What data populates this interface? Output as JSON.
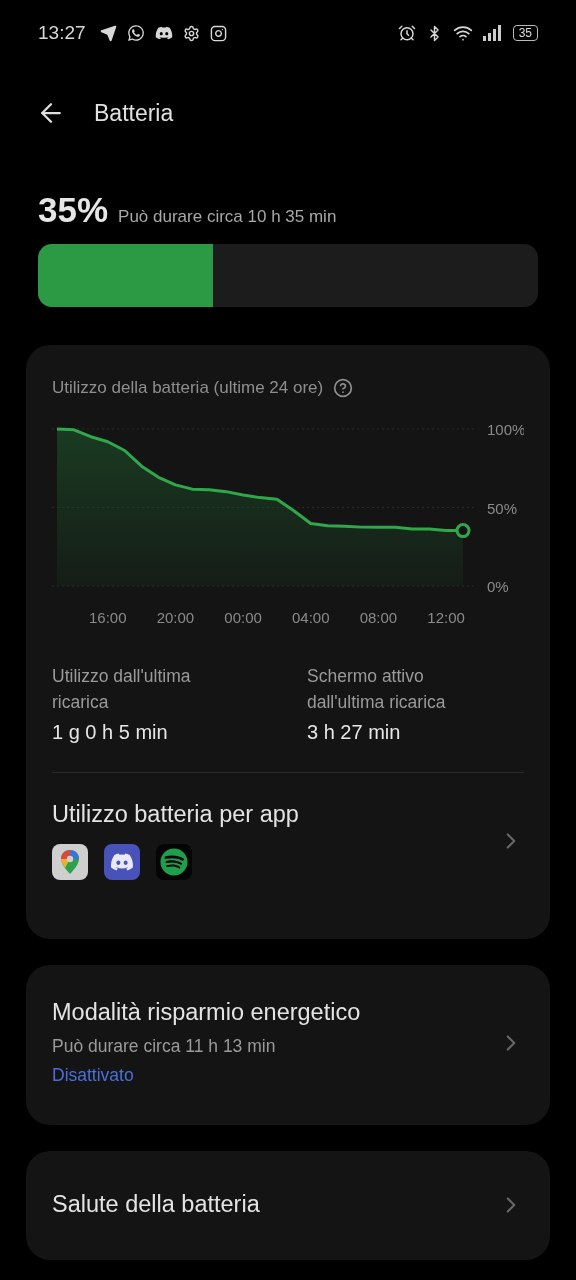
{
  "status_bar": {
    "time": "13:27",
    "battery": "35"
  },
  "header": {
    "title": "Batteria"
  },
  "battery": {
    "percent": "35%",
    "estimate": "Può durare circa 10 h 35 min",
    "level": 0.35
  },
  "usage_card": {
    "title": "Utilizzo della batteria (ultime 24 ore)",
    "chart_data": {
      "type": "area",
      "categories": [
        null,
        null,
        null,
        "16:00",
        null,
        null,
        null,
        "20:00",
        null,
        null,
        null,
        "00:00",
        null,
        null,
        null,
        "04:00",
        null,
        null,
        null,
        "08:00",
        null,
        null,
        null,
        "12:00",
        null
      ],
      "series": [
        {
          "color": "#2ea84a",
          "values": [
            100,
            99.5,
            95.1,
            91.9,
            86.3,
            76.3,
            69.2,
            64.4,
            61.7,
            61.3,
            60.1,
            58,
            56.3,
            55.2,
            47.9,
            39.8,
            38.4,
            38.1,
            37.5,
            37.4,
            37.4,
            36.3,
            36.3,
            35.3,
            35.3
          ]
        }
      ],
      "ylim": [
        0,
        100
      ],
      "yticks": [
        {
          "value": 100,
          "label": "100%"
        },
        {
          "value": 50,
          "label": "50%"
        },
        {
          "value": 0,
          "label": "0%"
        }
      ]
    },
    "stats": [
      {
        "label": "Utilizzo dall'ultima ricarica",
        "value": "1 g 0 h 5 min"
      },
      {
        "label": "Schermo attivo dall'ultima ricarica",
        "value": "3 h 27 min"
      }
    ],
    "apps_row": {
      "title": "Utilizzo batteria per app",
      "apps": [
        {
          "kind": "map"
        },
        {
          "kind": "chat"
        },
        {
          "kind": "music"
        }
      ]
    }
  },
  "settings": [
    {
      "title": "Modalità risparmio energetico",
      "subtitle": "Può durare circa 11 h 13 min",
      "status": "Disattivato"
    },
    {
      "title": "Salute della batteria"
    }
  ]
}
